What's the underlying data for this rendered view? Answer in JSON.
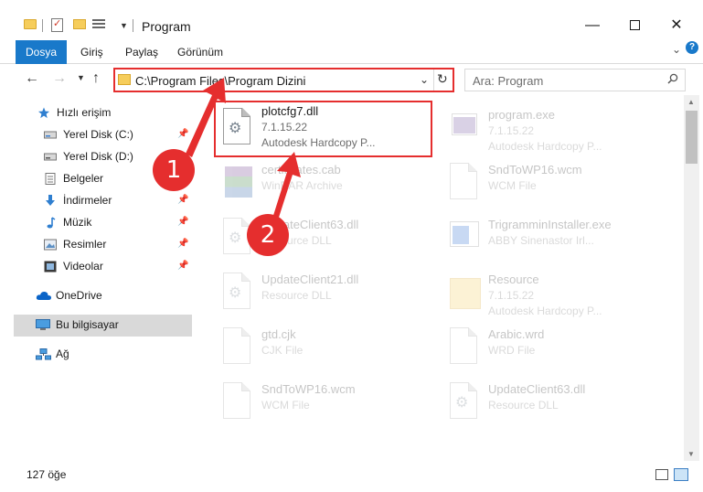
{
  "window": {
    "title": "Program",
    "controls": {
      "minimize": "—",
      "maximize": "",
      "close": "✕"
    }
  },
  "ribbon": {
    "tabs": [
      {
        "label": "Dosya",
        "active": true
      },
      {
        "label": "Giriş"
      },
      {
        "label": "Paylaş"
      },
      {
        "label": "Görünüm"
      }
    ],
    "help": "?"
  },
  "nav": {
    "back": "←",
    "forward": "→",
    "recent": "⌄",
    "up": "↑",
    "address": "C:\\Program Files\\Program Dizini",
    "refresh": "↻",
    "search_placeholder": "Ara: Program"
  },
  "sidebar": {
    "items": [
      {
        "label": "Hızlı erişim",
        "icon": "star-icon"
      },
      {
        "label": "Yerel Disk (C:)",
        "icon": "drive-icon",
        "pinned": true
      },
      {
        "label": "Yerel Disk (D:)",
        "icon": "drive-icon"
      },
      {
        "label": "Belgeler",
        "icon": "documents-icon"
      },
      {
        "label": "İndirmeler",
        "icon": "download-icon",
        "pinned": true
      },
      {
        "label": "Müzik",
        "icon": "music-icon",
        "pinned": true
      },
      {
        "label": "Resimler",
        "icon": "pictures-icon",
        "pinned": true
      },
      {
        "label": "Videolar",
        "icon": "video-icon",
        "pinned": true
      },
      {
        "label": "OneDrive",
        "icon": "cloud-icon"
      },
      {
        "label": "Bu bilgisayar",
        "icon": "computer-icon",
        "selected": true
      },
      {
        "label": "Ağ",
        "icon": "network-icon"
      }
    ]
  },
  "files": {
    "left": [
      {
        "name": "plotcfg7.dll",
        "line1": "7.1.15.22",
        "line2": "Autodesk Hardcopy P...",
        "highlighted": true
      },
      {
        "name": "certificates.cab",
        "line1": "WinRAR Archive"
      },
      {
        "name": "UpdateClient63.dll",
        "line1": "Resource DLL"
      },
      {
        "name": "UpdateClient21.dll",
        "line1": "Resource DLL"
      },
      {
        "name": "gtd.cjk",
        "line1": "CJK File"
      },
      {
        "name": "SndToWP16.wcm",
        "line1": "WCM File"
      }
    ],
    "right": [
      {
        "name": "program.exe",
        "line1": "7.1.15.22",
        "line2": "Autodesk Hardcopy P..."
      },
      {
        "name": "SndToWP16.wcm",
        "line1": "WCM File"
      },
      {
        "name": "TrigramminInstaller.exe",
        "line1": "ABBY Sinenastor Irl..."
      },
      {
        "name": "Resource",
        "line1": "7.1.15.22",
        "line2": "Autodesk Hardcopy P..."
      },
      {
        "name": "Arabic.wrd",
        "line1": "WRD File"
      },
      {
        "name": "UpdateClient63.dll",
        "line1": "Resource DLL"
      }
    ]
  },
  "status": {
    "count": "127 öğe"
  },
  "callouts": {
    "one": "1",
    "two": "2"
  },
  "colors": {
    "accent": "#1979ca",
    "highlight": "#e52e2e",
    "selected": "#d9d9d9"
  }
}
